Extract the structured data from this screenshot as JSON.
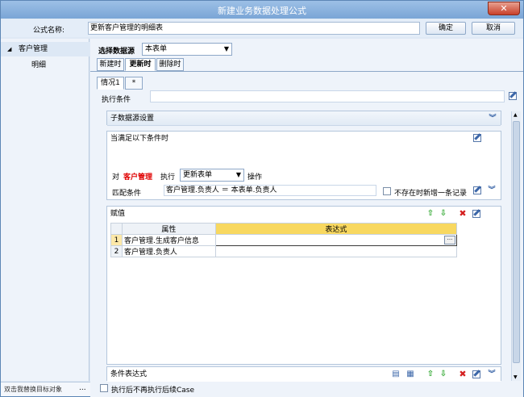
{
  "window": {
    "title": "新建业务数据处理公式",
    "close_glyph": "✕"
  },
  "formula": {
    "label": "公式名称:",
    "value": "更新客户管理的明细表",
    "ok_label": "确定",
    "cancel_label": "取消"
  },
  "sidebar": {
    "root_label": "客户管理",
    "child_label": "明细",
    "footer_text": "双击我替换目标对象",
    "footer_more": "..."
  },
  "datasource": {
    "label": "选择数据源",
    "selected": "本表单"
  },
  "tabs": [
    {
      "label": "新建时"
    },
    {
      "label": "更新时"
    },
    {
      "label": "删除时"
    }
  ],
  "case_tabs": [
    {
      "label": "情况1"
    },
    {
      "label": "*"
    }
  ],
  "exec_condition": {
    "label": "执行条件",
    "value": ""
  },
  "sub_data": {
    "title": "子数据源设置"
  },
  "condition": {
    "title": "当满足以下条件时",
    "target_prefix": "对",
    "target_name": "客户管理",
    "exec_label": "执行",
    "exec_selected": "更新表单",
    "exec_suffix": "操作",
    "match_label": "匹配条件",
    "match_value": "客户管理.负责人 ＝ 本表单.负责人",
    "not_exist_label": "不存在时新增一条记录"
  },
  "assign": {
    "title": "赋值",
    "col_property": "属性",
    "col_expression": "表达式",
    "rows": [
      {
        "num": "1",
        "property": "客户管理.生成客户信息",
        "expression": ""
      },
      {
        "num": "2",
        "property": "客户管理.负责人",
        "expression": ""
      }
    ],
    "ellipsis": "···"
  },
  "cond_expr": {
    "title": "条件表达式"
  },
  "footer": {
    "stop_label": "执行后不再执行后续Case"
  },
  "colors": {
    "accent": "#3b66a8",
    "header_yellow": "#f8d860",
    "red": "#e00000"
  }
}
